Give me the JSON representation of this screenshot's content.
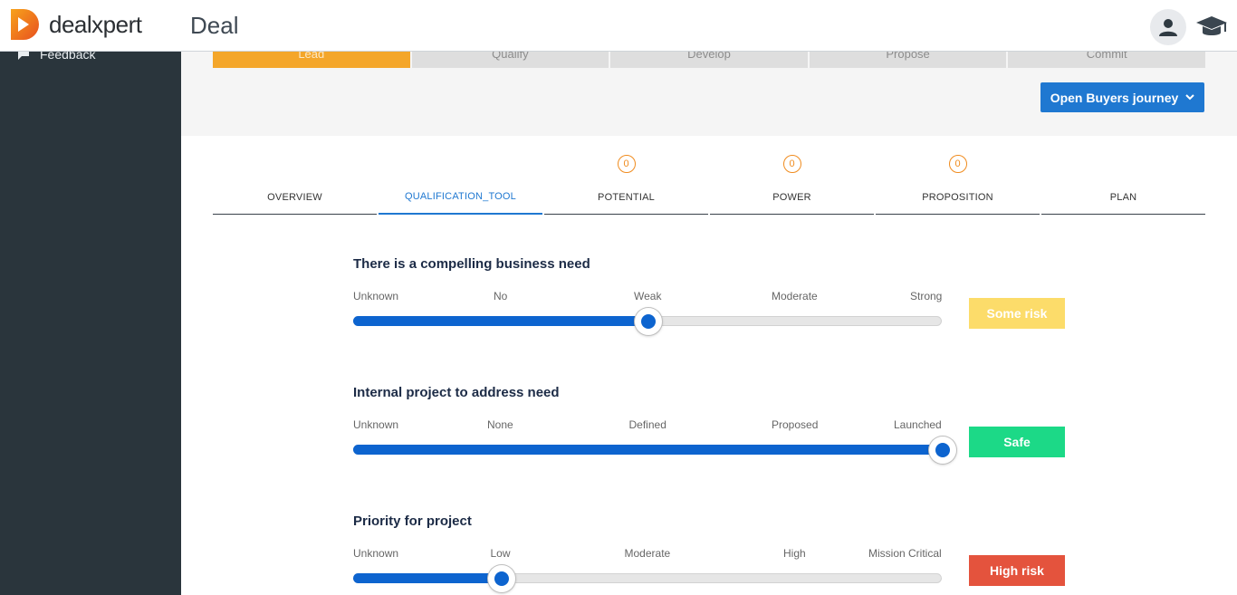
{
  "app": {
    "logo_text": "dealxpert",
    "page_title": "Deal"
  },
  "sidebar": {
    "items": [
      {
        "label": "Feedback",
        "icon": "chat-icon"
      }
    ]
  },
  "stages": [
    {
      "label": "Lead",
      "active": true
    },
    {
      "label": "Qualify",
      "active": false
    },
    {
      "label": "Develop",
      "active": false
    },
    {
      "label": "Propose",
      "active": false
    },
    {
      "label": "Commit",
      "active": false
    }
  ],
  "buyers_journey_button": {
    "label": "Open Buyers journey",
    "icon": "chevron-down-icon"
  },
  "tabs": [
    {
      "label": "OVERVIEW",
      "badge": null
    },
    {
      "label": "QUALIFICATION_TOOL",
      "badge": null,
      "active": true
    },
    {
      "label": "POTENTIAL",
      "badge": "0"
    },
    {
      "label": "POWER",
      "badge": "0"
    },
    {
      "label": "PROPOSITION",
      "badge": "0"
    },
    {
      "label": "PLAN",
      "badge": null
    }
  ],
  "questions": [
    {
      "title": "There is a compelling business need",
      "scale": [
        "Unknown",
        "No",
        "Weak",
        "Moderate",
        "Strong"
      ],
      "selected_index": 2,
      "risk": {
        "label": "Some risk",
        "color": "#fcdc6a"
      }
    },
    {
      "title": "Internal project to address need",
      "scale": [
        "Unknown",
        "None",
        "Defined",
        "Proposed",
        "Launched"
      ],
      "selected_index": 4,
      "risk": {
        "label": "Safe",
        "color": "#1cd987"
      }
    },
    {
      "title": "Priority for project",
      "scale": [
        "Unknown",
        "Low",
        "Moderate",
        "High",
        "Mission Critical"
      ],
      "selected_index": 1,
      "risk": {
        "label": "High risk",
        "color": "#e4533d"
      }
    }
  ],
  "colors": {
    "accent": "#1f78d1",
    "stage_active": "#f4a62a",
    "sidebar": "#2a353c",
    "badge": "#f08c1f"
  }
}
